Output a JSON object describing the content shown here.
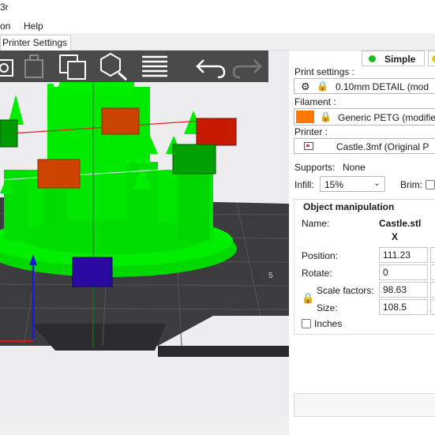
{
  "app": {
    "title_fragment": "3r"
  },
  "menu": {
    "items": [
      "on",
      "Help"
    ]
  },
  "tabs": {
    "printer_settings": "Printer Settings"
  },
  "toolbar": {
    "icons": [
      "add-icon",
      "delete-icon",
      "arrange-icon",
      "search-icon",
      "layers-icon",
      "undo-icon",
      "redo-icon"
    ]
  },
  "viewport": {
    "object_color": "#00ee00",
    "bed_color": "#3a3a3c",
    "marker_colors": {
      "orange": "#cc4400",
      "red": "#cc1a00",
      "green": "#009900",
      "blue": "#2a0aa0"
    }
  },
  "mode": {
    "simple_label": "Simple",
    "simple_color": "#22bb22",
    "advanced_color": "#f0c800"
  },
  "print_settings": {
    "label": "Print settings :",
    "value": "0.10mm DETAIL (mod"
  },
  "filament": {
    "label": "Filament :",
    "value": "Generic PETG (modifie",
    "color": "#ff7700"
  },
  "printer": {
    "label": "Printer :",
    "value": "Castle.3mf (Original P"
  },
  "supports": {
    "label": "Supports:",
    "value": "None"
  },
  "infill": {
    "label": "Infill:",
    "value": "15%"
  },
  "brim": {
    "label": "Brim:"
  },
  "object_manipulation": {
    "title": "Object manipulation",
    "name_label": "Name:",
    "name_value": "Castle.stl",
    "axis_x": "X",
    "position_label": "Position:",
    "position_x": "111.23",
    "rotate_label": "Rotate:",
    "rotate_x": "0",
    "scale_label": "Scale factors:",
    "scale_x": "98.63",
    "size_label": "Size:",
    "size_x": "108.5",
    "inches_label": "Inches"
  }
}
